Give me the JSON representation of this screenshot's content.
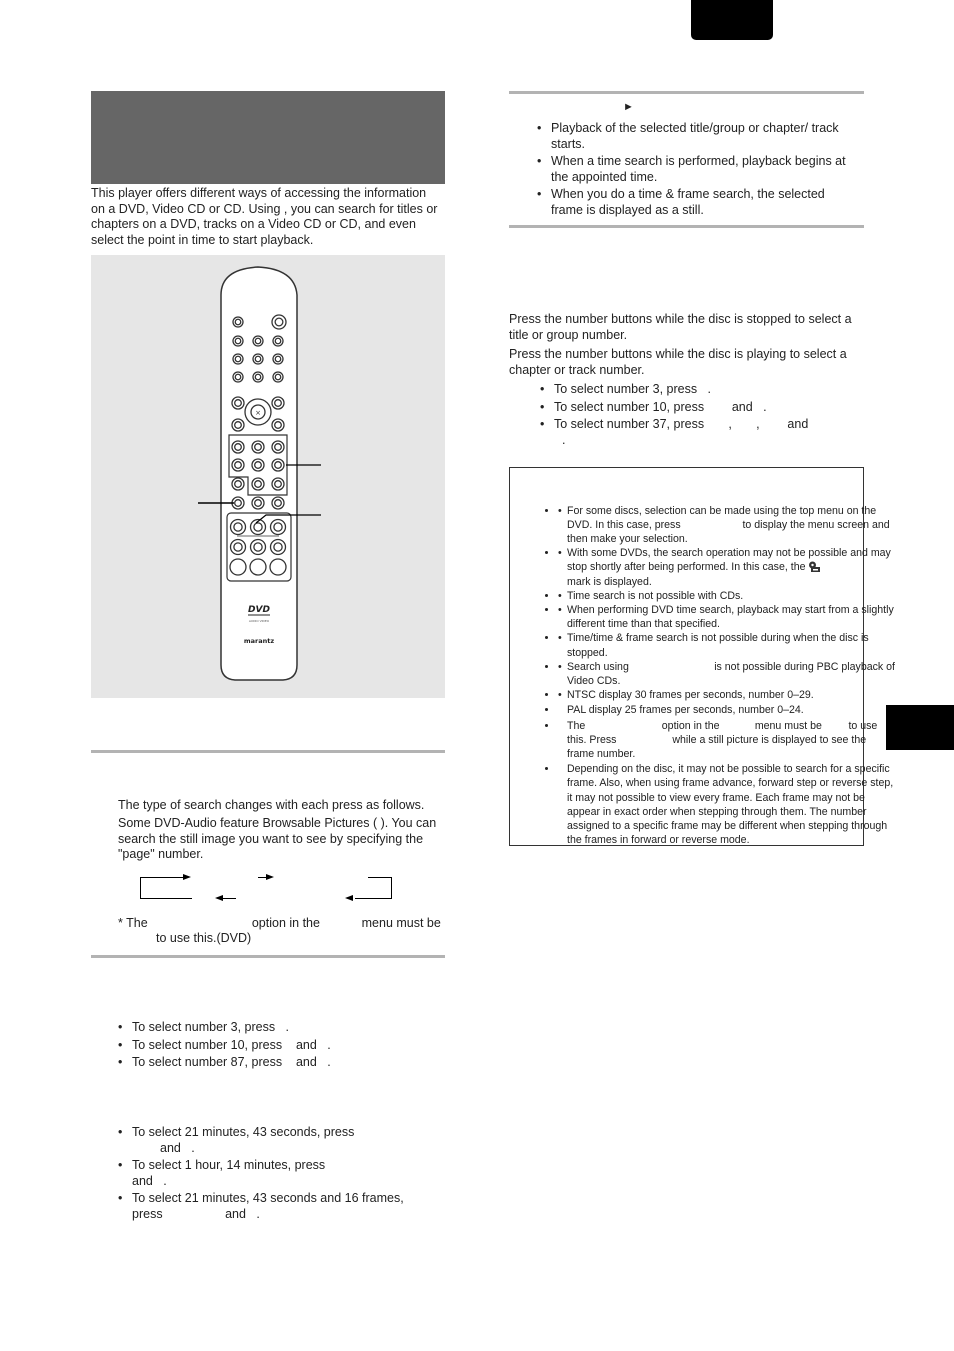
{
  "page": {
    "intro": "This player offers different ways of accessing the information on a DVD, Video CD or CD. Using                          , you can search for titles or chapters on a DVD, tracks on a Video CD or CD, and even select the point in time to start playback."
  },
  "remote": {
    "brand": "marantz",
    "logo": "DVD",
    "logo_sub": "AUDIO VIDEO"
  },
  "left": {
    "search_type_text": "The type of search changes with each press as follows.",
    "browsable_text": "Some DVD-Audio feature Browsable Pictures (          ). You can search the still image you want to see by specifying the \"page\" number.",
    "footnote_line1": "* The                              option in the            menu must be",
    "footnote_line2": "to use this.(DVD)",
    "number_examples": [
      "To select number 3, press   .",
      "To select number 10, press    and   .",
      "To select number 87, press    and   ."
    ],
    "time_examples": [
      "To select  21 minutes, 43 seconds, press",
      "and   .",
      "To select 1 hour, 14 minutes, press",
      "and   .",
      "To select  21 minutes, 43 seconds and 16 frames,",
      "press                  and   ."
    ]
  },
  "right": {
    "play_symbol": "►",
    "play_results": [
      "Playback of the selected title/group or chapter/ track starts.",
      "When a time search is performed, playback begins at the appointed time.",
      "When you do a time & frame search, the selected frame is displayed as a still."
    ],
    "stopped_text": "Press the number buttons while the disc is stopped to select a title or group number.",
    "playing_text": "Press the number buttons while the disc is playing to select a chapter or track number.",
    "number_examples": [
      "To select number 3, press   .",
      "To select number 10, press        and   .",
      "To select number 37, press       ,       ,        and",
      "."
    ],
    "notes": [
      "For some discs, selection can be made using the top menu on the DVD. In this case, press                     to display the menu screen and then make your selection.",
      "With some DVDs, the search operation may not be possible and may stop shortly after being performed. In this case, the",
      "mark is displayed.",
      "Time search is not possible with CDs.",
      "When performing DVD time search, playback may start from a slightly different time than that specified.",
      "Time/time & frame search is not possible during when the disc is stopped.",
      "Search using                             is not possible during PBC playback of Video CDs.",
      "NTSC display 30 frames per seconds, number 0–29.",
      "PAL display 25 frames per seconds, number 0–24.",
      "The                          option in the            menu must be         to use this. Press                   while a still picture is displayed to see the frame number.",
      "Depending on the disc, it may not be possible to search for a specific frame. Also, when using frame advance, forward step or reverse step, it may not possible to view every frame. Each frame may not be appear in exact order when stepping through them. The number assigned to a specific frame may be different when stepping through the frames in forward or reverse mode."
    ]
  }
}
